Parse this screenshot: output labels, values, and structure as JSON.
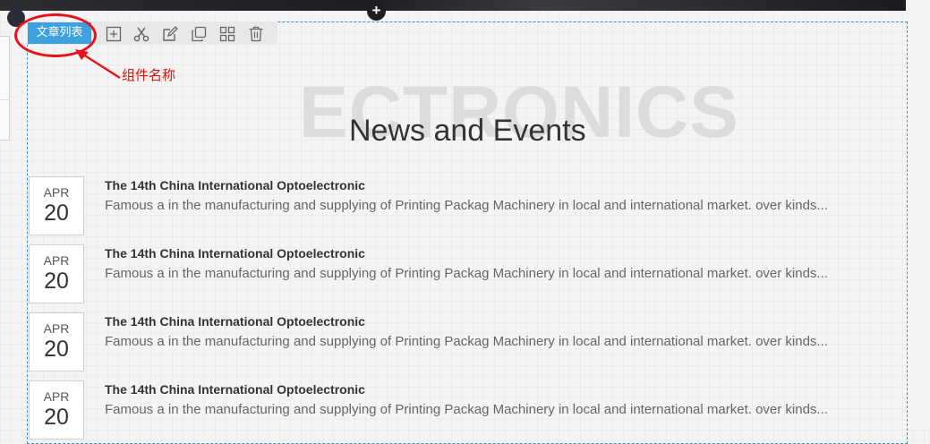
{
  "editor": {
    "component_name": "文章列表",
    "annotation": "组件名称",
    "tools": [
      "add-icon",
      "scissors-icon",
      "edit-icon",
      "copy-icon",
      "grid-icon",
      "trash-icon"
    ]
  },
  "section": {
    "background_word": "ECTRONICS",
    "title": "News and Events"
  },
  "news": [
    {
      "month": "APR",
      "day": "20",
      "title": "The 14th China International Optoelectronic",
      "desc": "Famous a in the manufacturing and supplying of Printing Packag Machinery in local and international market. over kinds..."
    },
    {
      "month": "APR",
      "day": "20",
      "title": "The 14th China International Optoelectronic",
      "desc": "Famous a in the manufacturing and supplying of Printing Packag Machinery in local and international market. over kinds..."
    },
    {
      "month": "APR",
      "day": "20",
      "title": "The 14th China International Optoelectronic",
      "desc": "Famous a in the manufacturing and supplying of Printing Packag Machinery in local and international market. over kinds..."
    },
    {
      "month": "APR",
      "day": "20",
      "title": "The 14th China International Optoelectronic",
      "desc": "Famous a in the manufacturing and supplying of Printing Packag Machinery in local and international market. over kinds..."
    }
  ],
  "colors": {
    "accent": "#3ea0dd",
    "annotation": "#e8131a",
    "selection_border": "#3b8fd0"
  }
}
